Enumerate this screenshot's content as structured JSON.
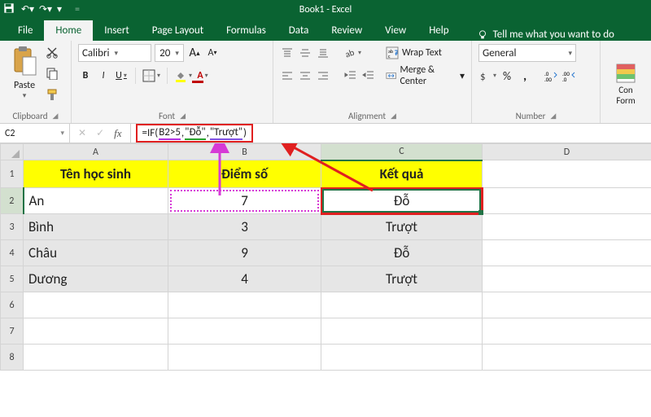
{
  "title": "Book1 - Excel",
  "qat": {
    "save": "save-icon",
    "undo": "undo-icon",
    "redo": "redo-icon"
  },
  "tabs": [
    "File",
    "Home",
    "Insert",
    "Page Layout",
    "Formulas",
    "Data",
    "Review",
    "View",
    "Help"
  ],
  "active_tab": "Home",
  "tell_me": "Tell me what you want to do",
  "ribbon": {
    "clipboard": {
      "paste": "Paste",
      "label": "Clipboard"
    },
    "font": {
      "name": "Calibri",
      "size": "20",
      "bold": "B",
      "italic": "I",
      "underline": "U",
      "increase": "A",
      "decrease": "A",
      "label": "Font"
    },
    "alignment": {
      "wrap": "Wrap Text",
      "merge": "Merge & Center",
      "label": "Alignment"
    },
    "number": {
      "format": "General",
      "label": "Number"
    },
    "styles": {
      "cond1": "Con",
      "cond2": "Form"
    }
  },
  "namebox": "C2",
  "formula": {
    "raw": "=IF(B2>5,\"Đỗ\",\"Trượt\")",
    "pre": "=IF(",
    "arg1": "B2>5",
    "sep1": ",",
    "arg2": "\"Đỗ\"",
    "sep2": ",",
    "arg3": "\"Trượt\"",
    "post": ")",
    "fx": "fx",
    "cancel": "✕",
    "enter": "✓"
  },
  "columns": [
    "A",
    "B",
    "C",
    "D"
  ],
  "rows": [
    "1",
    "2",
    "3",
    "4",
    "5",
    "6",
    "7",
    "8"
  ],
  "headers": {
    "A": "Tên học sinh",
    "B": "Điểm số",
    "C": "Kết quả"
  },
  "data": [
    {
      "name": "An",
      "score": "7",
      "result": "Đỗ"
    },
    {
      "name": "Bình",
      "score": "3",
      "result": "Trượt"
    },
    {
      "name": "Châu",
      "score": "9",
      "result": "Đỗ"
    },
    {
      "name": "Dương",
      "score": "4",
      "result": "Trượt"
    }
  ],
  "chart_data": {
    "type": "table",
    "columns": [
      "Tên học sinh",
      "Điểm số",
      "Kết quả"
    ],
    "rows": [
      [
        "An",
        "7",
        "Đỗ"
      ],
      [
        "Bình",
        "3",
        "Trượt"
      ],
      [
        "Châu",
        "9",
        "Đỗ"
      ],
      [
        "Dương",
        "4",
        "Trượt"
      ]
    ],
    "formula_cell": "C2",
    "formula": "=IF(B2>5,\"Đỗ\",\"Trượt\")"
  }
}
